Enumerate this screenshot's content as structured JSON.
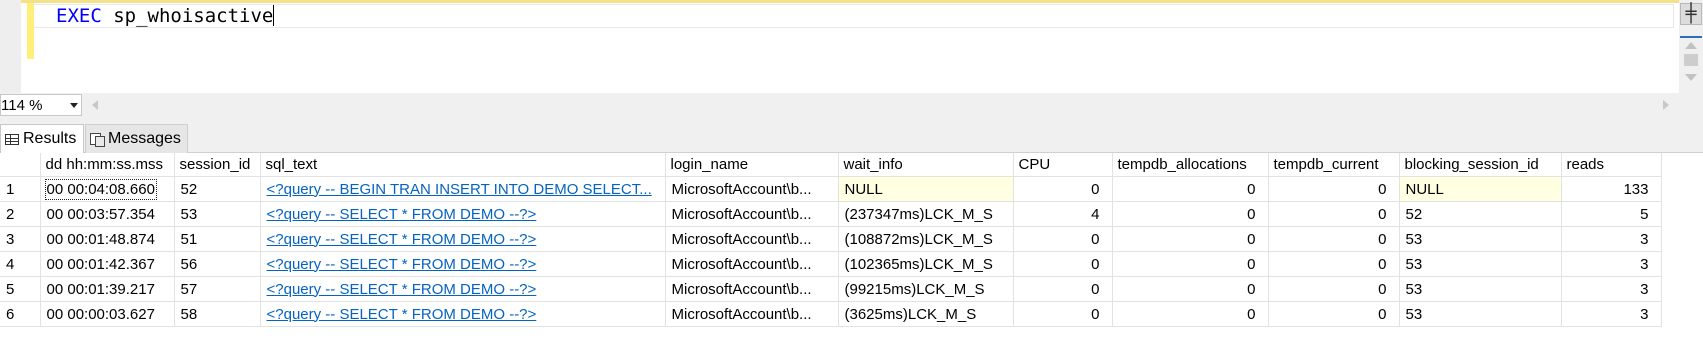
{
  "editor": {
    "keyword": "EXEC",
    "procedure": "sp_whoisactive",
    "split_glyph": "╪"
  },
  "zoom": {
    "value": "114 %"
  },
  "tabs": [
    {
      "label": "Results",
      "icon": "grid-icon",
      "active": true
    },
    {
      "label": "Messages",
      "icon": "messages-icon",
      "active": false
    }
  ],
  "results": {
    "columns": [
      "dd hh:mm:ss.mss",
      "session_id",
      "sql_text",
      "login_name",
      "wait_info",
      "CPU",
      "tempdb_allocations",
      "tempdb_current",
      "blocking_session_id",
      "reads"
    ],
    "rows": [
      {
        "num": "1",
        "dd": "00 00:04:08.660",
        "session_id": "52",
        "sql_text": "<?query --  BEGIN TRAN  INSERT INTO DEMO  SELECT...",
        "login_name": "MicrosoftAccount\\b...",
        "wait_info": "NULL",
        "cpu": "0",
        "tempdb_allocations": "0",
        "tempdb_current": "0",
        "blocking_session_id": "NULL",
        "reads": "133"
      },
      {
        "num": "2",
        "dd": "00 00:03:57.354",
        "session_id": "53",
        "sql_text": "<?query --  SELECT * FROM DEMO  --?>",
        "login_name": "MicrosoftAccount\\b...",
        "wait_info": "(237347ms)LCK_M_S",
        "cpu": "4",
        "tempdb_allocations": "0",
        "tempdb_current": "0",
        "blocking_session_id": "52",
        "reads": "5"
      },
      {
        "num": "3",
        "dd": "00 00:01:48.874",
        "session_id": "51",
        "sql_text": "<?query --  SELECT * FROM DEMO  --?>",
        "login_name": "MicrosoftAccount\\b...",
        "wait_info": "(108872ms)LCK_M_S",
        "cpu": "0",
        "tempdb_allocations": "0",
        "tempdb_current": "0",
        "blocking_session_id": "53",
        "reads": "3"
      },
      {
        "num": "4",
        "dd": "00 00:01:42.367",
        "session_id": "56",
        "sql_text": "<?query --  SELECT * FROM DEMO  --?>",
        "login_name": "MicrosoftAccount\\b...",
        "wait_info": "(102365ms)LCK_M_S",
        "cpu": "0",
        "tempdb_allocations": "0",
        "tempdb_current": "0",
        "blocking_session_id": "53",
        "reads": "3"
      },
      {
        "num": "5",
        "dd": "00 00:01:39.217",
        "session_id": "57",
        "sql_text": "<?query --  SELECT * FROM DEMO  --?>",
        "login_name": "MicrosoftAccount\\b...",
        "wait_info": "(99215ms)LCK_M_S",
        "cpu": "0",
        "tempdb_allocations": "0",
        "tempdb_current": "0",
        "blocking_session_id": "53",
        "reads": "3"
      },
      {
        "num": "6",
        "dd": "00 00:00:03.627",
        "session_id": "58",
        "sql_text": "<?query --  SELECT * FROM DEMO  --?>",
        "login_name": "MicrosoftAccount\\b...",
        "wait_info": "(3625ms)LCK_M_S",
        "cpu": "0",
        "tempdb_allocations": "0",
        "tempdb_current": "0",
        "blocking_session_id": "53",
        "reads": "3"
      }
    ]
  },
  "colors": {
    "keyword": "#0000ff",
    "link": "#0563c1",
    "null_cell_bg": "#ffffe1",
    "change_bar": "#ffef7a"
  }
}
